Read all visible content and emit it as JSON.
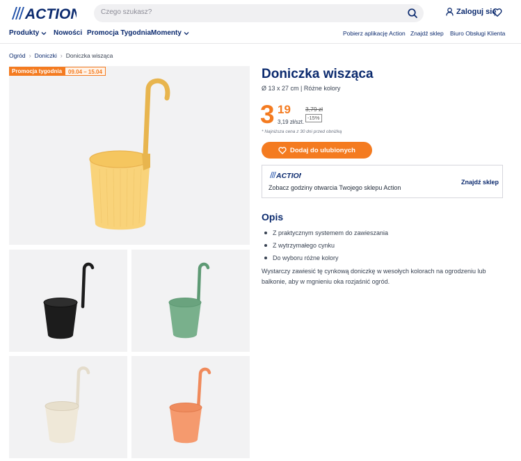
{
  "header": {
    "logo_text": "ACTION",
    "search_placeholder": "Czego szukasz?",
    "login_label": "Zaloguj się"
  },
  "nav": {
    "left": [
      {
        "label": "Produkty"
      },
      {
        "label": "Nowości"
      },
      {
        "label": "Promocja Tygodnia"
      },
      {
        "label": "Momenty"
      }
    ],
    "right": [
      {
        "label": "Pobierz aplikację Action"
      },
      {
        "label": "Znajdź sklep"
      },
      {
        "label": "Biuro Obsługi Klienta"
      }
    ]
  },
  "breadcrumb": [
    "Ogród",
    "Doniczki",
    "Doniczka wisząca"
  ],
  "promo": {
    "label": "Promocja tygodnia",
    "dates": "09.04 – 15.04"
  },
  "gallery": {
    "colors": [
      "#f9d37a",
      "#1c1c1c",
      "#79b08c",
      "#efe8d8",
      "#f59a6e"
    ],
    "accent_main": "#e8b54e"
  },
  "product": {
    "title": "Doniczka wisząca",
    "subtitle": "Ø 13 x 27 cm | Różne kolory",
    "price_int": "3",
    "price_dec": "19",
    "price_unit": "3,19 zł/szt.",
    "old_price": "3,79 zł",
    "discount": "-15%",
    "lowest_note": "* Najniższa cena z 30 dni przed obniżką",
    "favorite_button": "Dodaj do ulubionych",
    "accent_color": "#f47b20"
  },
  "store": {
    "logo_text": "ACTION",
    "text": "Zobacz godziny otwarcia Twojego sklepu Action",
    "link": "Znajdź sklep"
  },
  "description": {
    "heading": "Opis",
    "bullets": [
      "Z praktycznym systemem do zawieszania",
      "Z wytrzymałego cynku",
      "Do wyboru różne kolory"
    ],
    "text": "Wystarczy zawiesić tę cynkową doniczkę w wesołych kolorach na ogrodzeniu lub balkonie, aby w mgnieniu oka rozjaśnić ogród."
  }
}
